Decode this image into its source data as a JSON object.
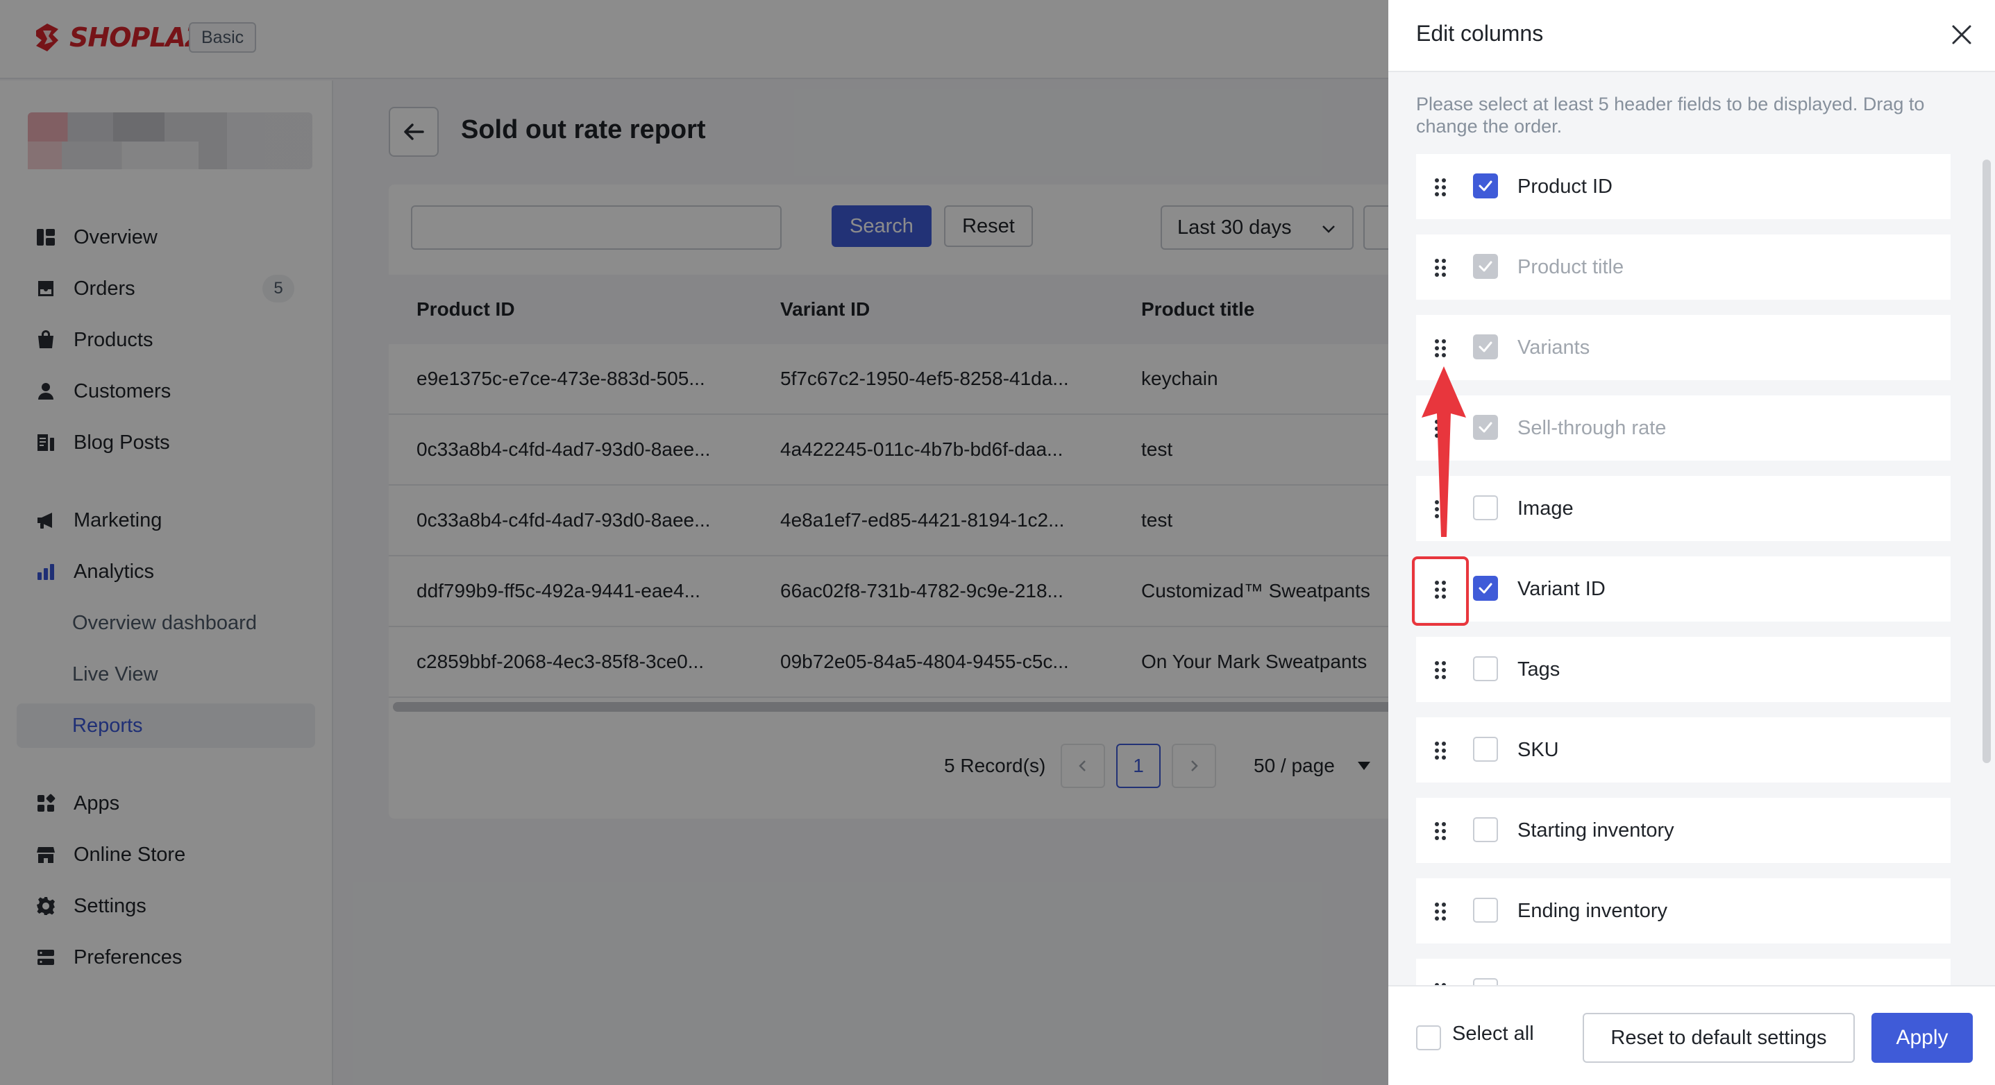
{
  "app": {
    "brand": "SHOPLAZZA",
    "plan_badge": "Basic"
  },
  "sidebar": {
    "items": [
      {
        "label": "Overview",
        "icon": "overview-icon"
      },
      {
        "label": "Orders",
        "icon": "orders-icon",
        "count": "5"
      },
      {
        "label": "Products",
        "icon": "products-icon"
      },
      {
        "label": "Customers",
        "icon": "customers-icon"
      },
      {
        "label": "Blog Posts",
        "icon": "blog-icon"
      },
      {
        "label": "Marketing",
        "icon": "megaphone-icon"
      },
      {
        "label": "Analytics",
        "icon": "bar-chart-icon"
      },
      {
        "label": "Overview dashboard"
      },
      {
        "label": "Live View"
      },
      {
        "label": "Reports",
        "active": true
      },
      {
        "label": "Apps",
        "icon": "apps-icon"
      },
      {
        "label": "Online Store",
        "icon": "store-icon"
      },
      {
        "label": "Settings",
        "icon": "gear-icon"
      },
      {
        "label": "Preferences",
        "icon": "preferences-icon"
      }
    ]
  },
  "page": {
    "title": "Sold out rate report",
    "search": {
      "placeholder": "",
      "button": "Search",
      "reset": "Reset"
    },
    "date_range": "Last 30 days"
  },
  "table": {
    "columns": [
      "Product ID",
      "Variant ID",
      "Product title"
    ],
    "rows": [
      [
        "e9e1375c-e7ce-473e-883d-505...",
        "5f7c67c2-1950-4ef5-8258-41da...",
        "keychain"
      ],
      [
        "0c33a8b4-c4fd-4ad7-93d0-8aee...",
        "4a422245-011c-4b7b-bd6f-daa...",
        "test"
      ],
      [
        "0c33a8b4-c4fd-4ad7-93d0-8aee...",
        "4e8a1ef7-ed85-4421-8194-1c2...",
        "test"
      ],
      [
        "ddf799b9-ff5c-492a-9441-eae4...",
        "66ac02f8-731b-4782-9c9e-218...",
        "Customizad™ Sweatpants"
      ],
      [
        "c2859bbf-2068-4ec3-85f8-3ce0...",
        "09b72e05-84a5-4804-9455-c5c...",
        "On Your Mark Sweatpants"
      ]
    ]
  },
  "pagination": {
    "records": "5 Record(s)",
    "current_page": "1",
    "per_page": "50 / page"
  },
  "drawer": {
    "title": "Edit columns",
    "hint": "Please select at least 5 header fields to be displayed. Drag to change the order.",
    "columns": [
      {
        "label": "Product ID",
        "state": "checked"
      },
      {
        "label": "Product title",
        "state": "disabled"
      },
      {
        "label": "Variants",
        "state": "disabled"
      },
      {
        "label": "Sell-through rate",
        "state": "disabled"
      },
      {
        "label": "Image",
        "state": "unchecked"
      },
      {
        "label": "Variant ID",
        "state": "checked"
      },
      {
        "label": "Tags",
        "state": "unchecked"
      },
      {
        "label": "SKU",
        "state": "unchecked"
      },
      {
        "label": "Starting inventory",
        "state": "unchecked"
      },
      {
        "label": "Ending inventory",
        "state": "unchecked"
      }
    ],
    "footer": {
      "select_all": "Select all",
      "reset_default": "Reset to default settings",
      "apply": "Apply"
    }
  },
  "colors": {
    "primary": "#3f5bd8",
    "annotation": "#e8363d",
    "brand": "#d8262d"
  }
}
